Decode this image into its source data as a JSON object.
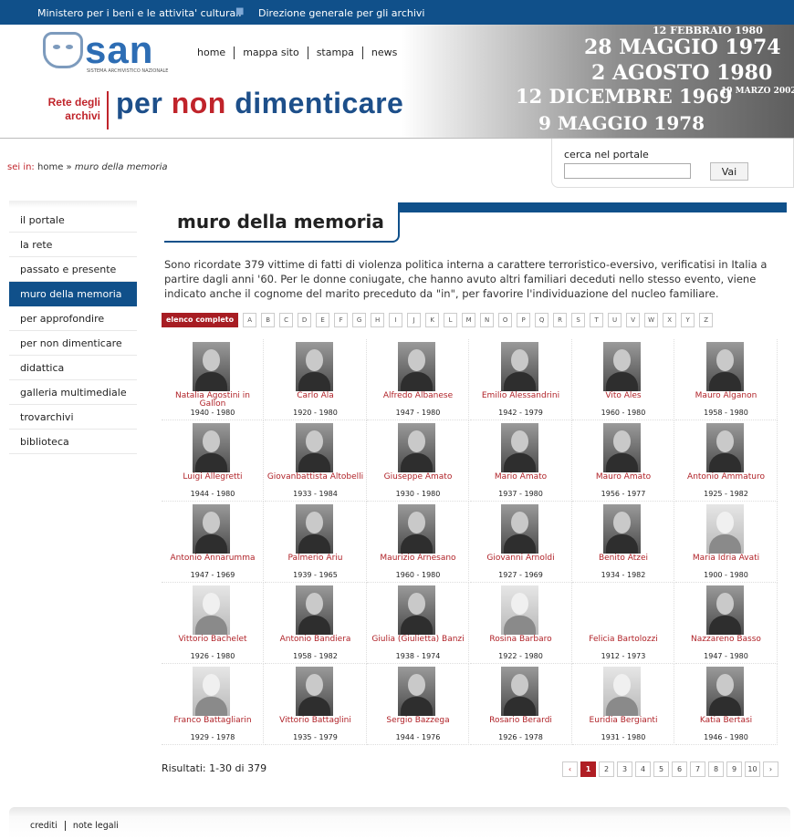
{
  "topbar": {
    "ministry": "Ministero per i beni e le attivita' culturali",
    "direction": "Direzione generale per gli archivi"
  },
  "logo": {
    "text": "san",
    "subtitle": "SISTEMA ARCHIVISTICO NAZIONALE"
  },
  "top_nav": [
    "home",
    "mappa sito",
    "stampa",
    "news"
  ],
  "brand": {
    "rete_line1": "Rete degli",
    "rete_line2": "archivi",
    "title_part1": "per ",
    "title_part2": "non",
    "title_part3": " dimenticare"
  },
  "banner_dates": [
    "28 MAGGIO 1974",
    "2 AGOSTO 1980",
    "12 DICEMBRE 1969",
    "9 MAGGIO 1978",
    "12 FEBBRAIO 1980",
    "19 MARZO 2002"
  ],
  "breadcrumb": {
    "label": "sei in:",
    "home": "home",
    "separator": "»",
    "current": "muro della memoria"
  },
  "search": {
    "label": "cerca nel portale",
    "value": "",
    "button": "Vai"
  },
  "sidebar": {
    "items": [
      {
        "label": "il portale",
        "active": false
      },
      {
        "label": "la rete",
        "active": false
      },
      {
        "label": "passato e presente",
        "active": false
      },
      {
        "label": "muro della memoria",
        "active": true
      },
      {
        "label": "per approfondire",
        "active": false
      },
      {
        "label": "per non dimenticare",
        "active": false
      },
      {
        "label": "didattica",
        "active": false
      },
      {
        "label": "galleria multimediale",
        "active": false
      },
      {
        "label": "trovarchivi",
        "active": false
      },
      {
        "label": "biblioteca",
        "active": false
      }
    ]
  },
  "page": {
    "title": "muro della memoria",
    "intro": "Sono ricordate 379 vittime di fatti di violenza politica interna a carattere terroristico-eversivo, verificatisi in Italia a partire dagli anni '60. Per le donne coniugate, che hanno avuto altri familiari deceduti nello stesso evento, viene indicato anche il cognome del marito preceduto da \"in\", per favorire l'individuazione del nucleo familiare."
  },
  "alphabet": {
    "all_label": "elenco completo",
    "letters": [
      "A",
      "B",
      "C",
      "D",
      "E",
      "F",
      "G",
      "H",
      "I",
      "J",
      "K",
      "L",
      "M",
      "N",
      "O",
      "P",
      "Q",
      "R",
      "S",
      "T",
      "U",
      "V",
      "W",
      "X",
      "Y",
      "Z"
    ]
  },
  "victims": [
    {
      "name": "Natalia Agostini in Gallon",
      "years": "1940 - 1980",
      "photo": "dark"
    },
    {
      "name": "Carlo Ala",
      "years": "1920 - 1980",
      "photo": "dark"
    },
    {
      "name": "Alfredo Albanese",
      "years": "1947 - 1980",
      "photo": "dark"
    },
    {
      "name": "Emilio Alessandrini",
      "years": "1942 - 1979",
      "photo": "dark"
    },
    {
      "name": "Vito Ales",
      "years": "1960 - 1980",
      "photo": "dark"
    },
    {
      "name": "Mauro Alganon",
      "years": "1958 - 1980",
      "photo": "dark"
    },
    {
      "name": "Luigi Allegretti",
      "years": "1944 - 1980",
      "photo": "dark"
    },
    {
      "name": "Giovanbattista Altobelli",
      "years": "1933 - 1984",
      "photo": "dark"
    },
    {
      "name": "Giuseppe Amato",
      "years": "1930 - 1980",
      "photo": "dark"
    },
    {
      "name": "Mario Amato",
      "years": "1937 - 1980",
      "photo": "dark"
    },
    {
      "name": "Mauro Amato",
      "years": "1956 - 1977",
      "photo": "dark"
    },
    {
      "name": "Antonio Ammaturo",
      "years": "1925 - 1982",
      "photo": "dark"
    },
    {
      "name": "Antonio Annarumma",
      "years": "1947 - 1969",
      "photo": "dark"
    },
    {
      "name": "Palmerio Ariu",
      "years": "1939 - 1965",
      "photo": "dark"
    },
    {
      "name": "Maurizio Arnesano",
      "years": "1960 - 1980",
      "photo": "dark"
    },
    {
      "name": "Giovanni Arnoldi",
      "years": "1927 - 1969",
      "photo": "dark"
    },
    {
      "name": "Benito Atzei",
      "years": "1934 - 1982",
      "photo": "dark"
    },
    {
      "name": "Maria Idria Avati",
      "years": "1900 - 1980",
      "photo": "light"
    },
    {
      "name": "Vittorio Bachelet",
      "years": "1926 - 1980",
      "photo": "light"
    },
    {
      "name": "Antonio Bandiera",
      "years": "1958 - 1982",
      "photo": "dark"
    },
    {
      "name": "Giulia (Giulietta) Banzi",
      "years": "1938 - 1974",
      "photo": "dark"
    },
    {
      "name": "Rosina Barbaro",
      "years": "1922 - 1980",
      "photo": "light"
    },
    {
      "name": "Felicia Bartolozzi",
      "years": "1912 - 1973",
      "photo": "empty"
    },
    {
      "name": "Nazzareno Basso",
      "years": "1947 - 1980",
      "photo": "dark"
    },
    {
      "name": "Franco Battagliarin",
      "years": "1929 - 1978",
      "photo": "light"
    },
    {
      "name": "Vittorio Battaglini",
      "years": "1935 - 1979",
      "photo": "dark"
    },
    {
      "name": "Sergio Bazzega",
      "years": "1944 - 1976",
      "photo": "dark"
    },
    {
      "name": "Rosario Berardi",
      "years": "1926 - 1978",
      "photo": "dark"
    },
    {
      "name": "Euridia Bergianti",
      "years": "1931 - 1980",
      "photo": "light"
    },
    {
      "name": "Katia Bertasi",
      "years": "1946 - 1980",
      "photo": "dark"
    }
  ],
  "results": {
    "text": "Risultati: 1-30 di 379"
  },
  "pagination": {
    "prev": "‹",
    "next": "›",
    "pages": [
      "1",
      "2",
      "3",
      "4",
      "5",
      "6",
      "7",
      "8",
      "9",
      "10"
    ],
    "current": "1"
  },
  "footer": {
    "links": [
      "crediti",
      "note legali"
    ]
  }
}
